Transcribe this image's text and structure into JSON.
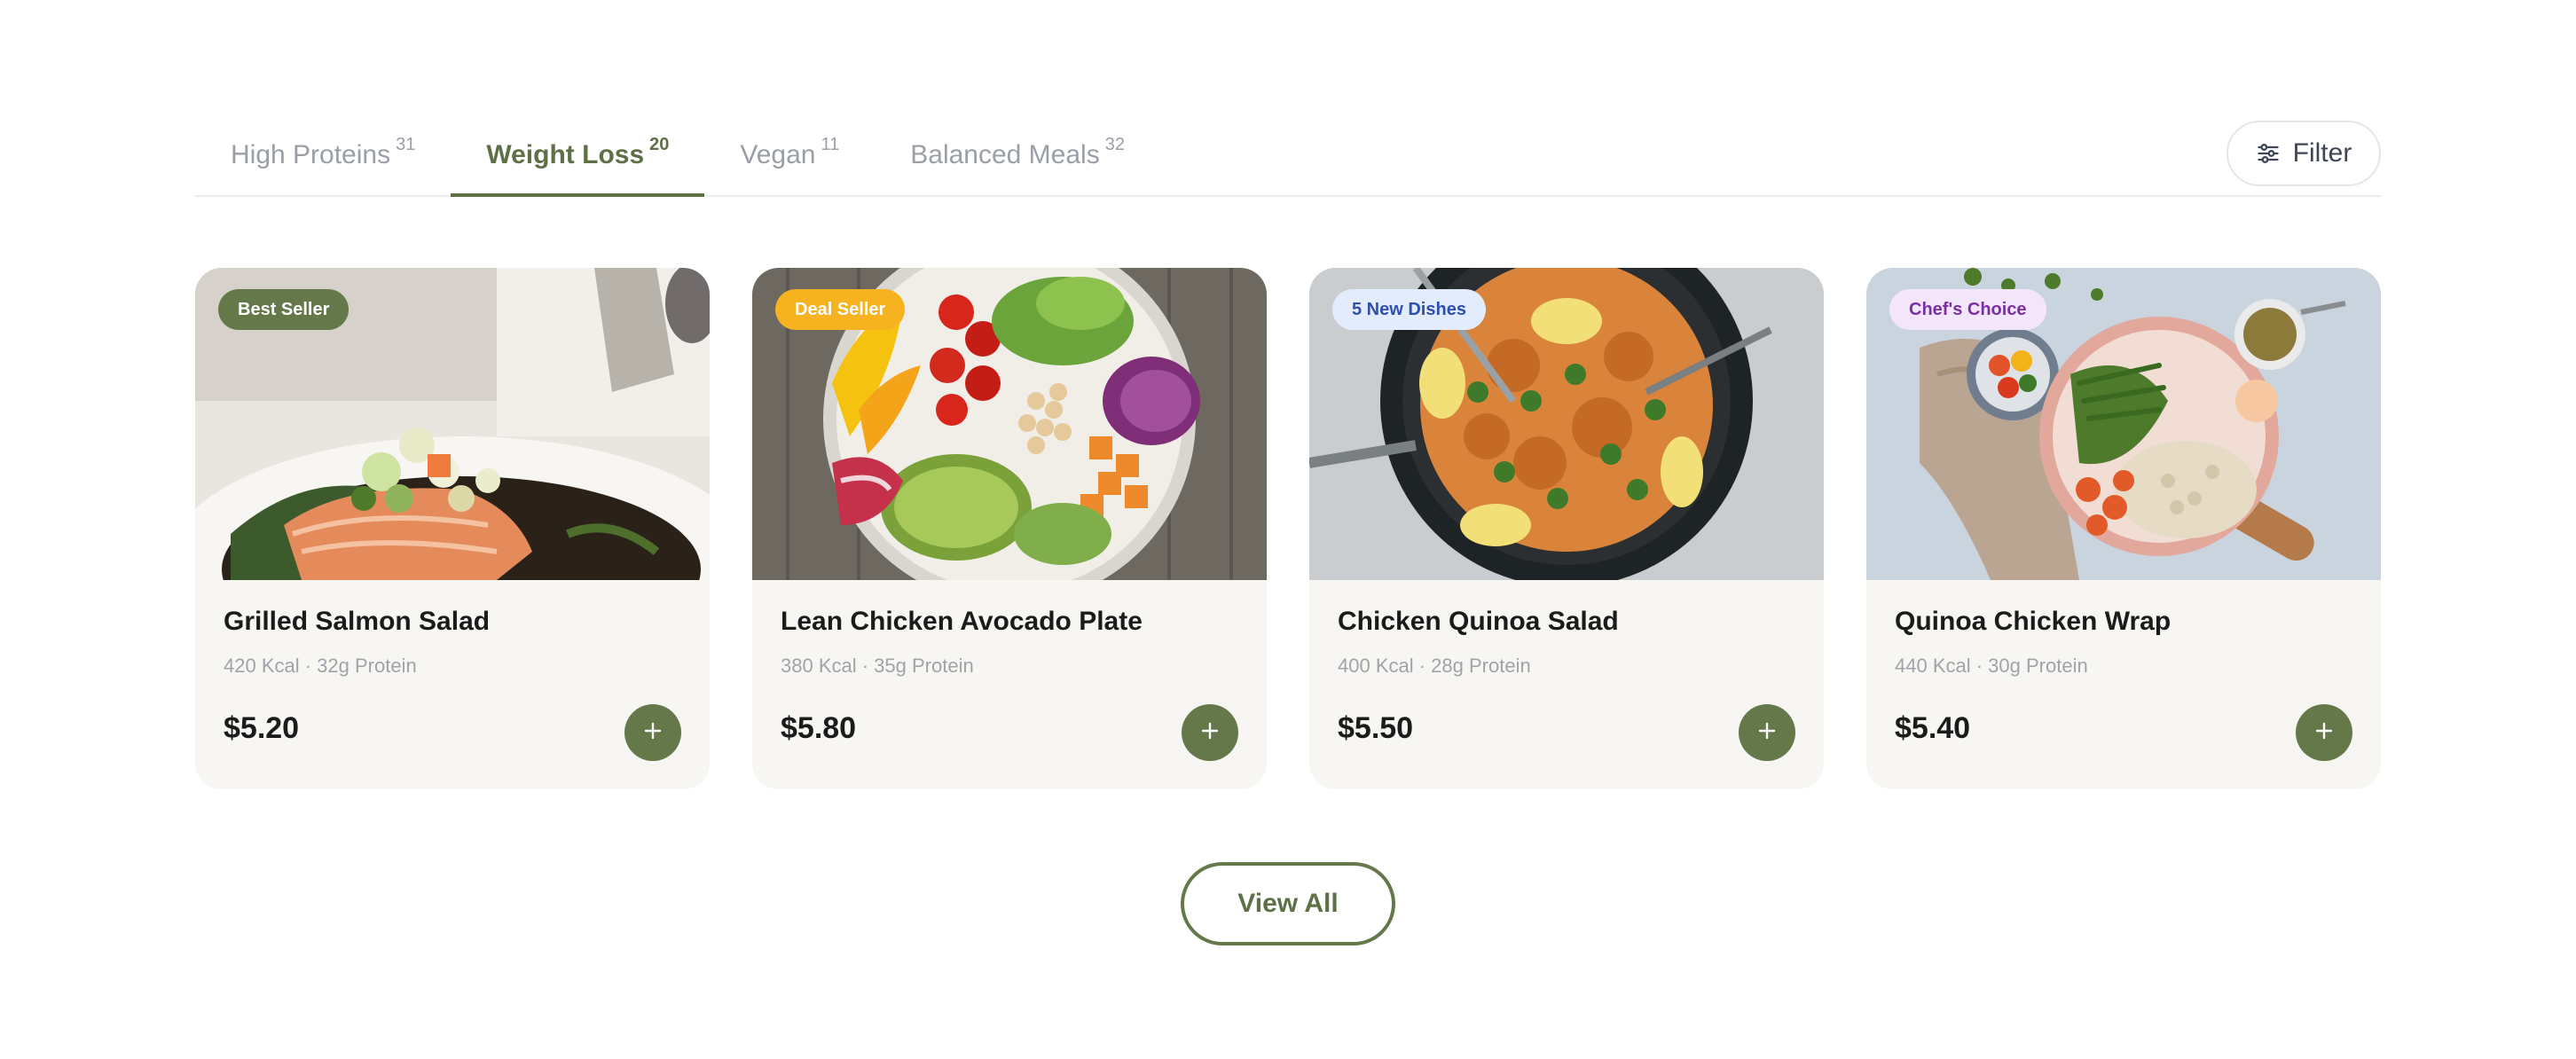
{
  "tabs": [
    {
      "label": "High Proteins",
      "count": "31",
      "active": false
    },
    {
      "label": "Weight Loss",
      "count": "20",
      "active": true
    },
    {
      "label": "Vegan",
      "count": "11",
      "active": false
    },
    {
      "label": "Balanced Meals",
      "count": "32",
      "active": false
    }
  ],
  "filter": {
    "label": "Filter",
    "icon": "sliders-icon"
  },
  "cards": [
    {
      "badge": "Best Seller",
      "badge_bg": "#65784a",
      "badge_color": "#ffffff",
      "title": "Grilled Salmon Salad",
      "meta": "420 Kcal · 32g Protein",
      "price": "$5.20"
    },
    {
      "badge": "Deal Seller",
      "badge_bg": "#f6b21f",
      "badge_color": "#ffffff",
      "title": "Lean Chicken Avocado Plate",
      "meta": "380 Kcal · 35g Protein",
      "price": "$5.80"
    },
    {
      "badge": "5 New Dishes",
      "badge_bg": "#e3ecfd",
      "badge_color": "#2f4fb0",
      "title": "Chicken Quinoa Salad",
      "meta": "400 Kcal · 28g Protein",
      "price": "$5.50"
    },
    {
      "badge": "Chef's Choice",
      "badge_bg": "#f3e6fb",
      "badge_color": "#7a2fa3",
      "title": "Quinoa Chicken Wrap",
      "meta": "440 Kcal · 30g Protein",
      "price": "$5.40"
    }
  ],
  "view_all": {
    "label": "View All"
  },
  "colors": {
    "accent": "#65784a",
    "tab_inactive": "#9a9ea6",
    "card_bg": "#f7f6f2"
  }
}
